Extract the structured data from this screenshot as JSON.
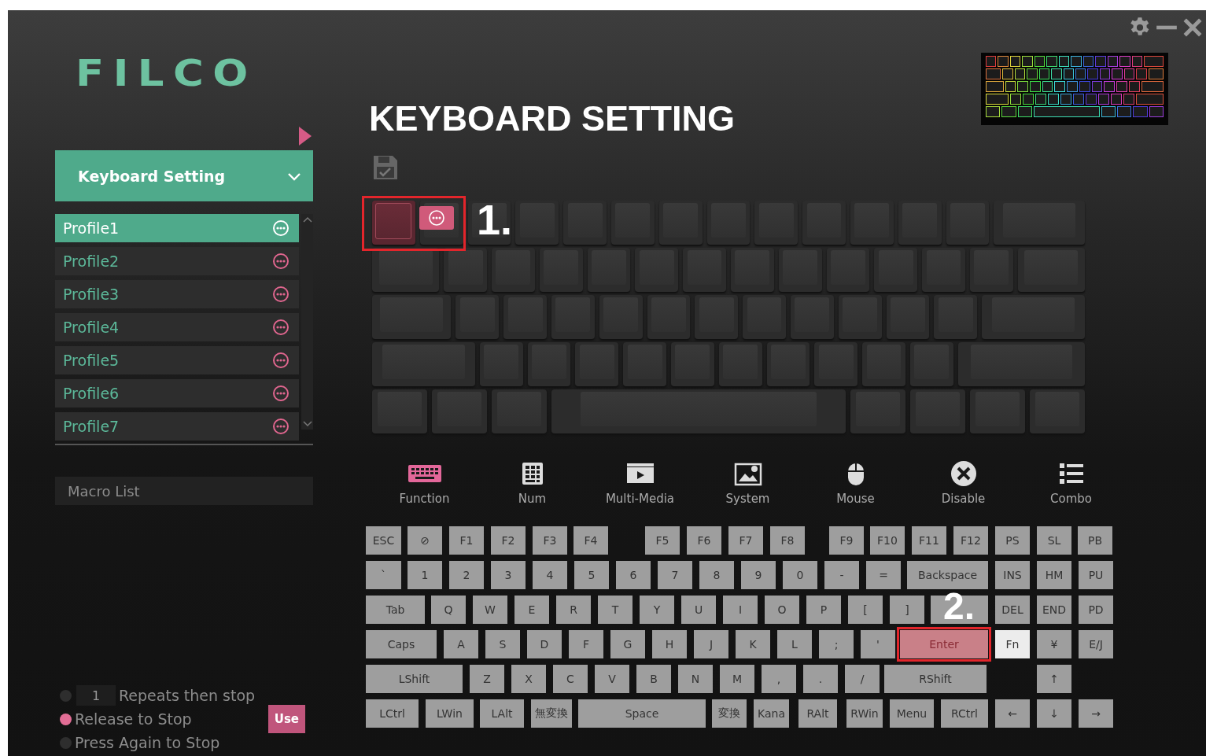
{
  "logo": "FILCO",
  "sidebar": {
    "section": {
      "label": "Keyboard Setting",
      "expanded": true
    },
    "profiles": [
      {
        "label": "Profile1",
        "selected": true
      },
      {
        "label": "Profile2",
        "selected": false
      },
      {
        "label": "Profile3",
        "selected": false
      },
      {
        "label": "Profile4",
        "selected": false
      },
      {
        "label": "Profile5",
        "selected": false
      },
      {
        "label": "Profile6",
        "selected": false
      },
      {
        "label": "Profile7",
        "selected": false
      }
    ],
    "macro_list": {
      "label": "Macro List"
    },
    "stop_options": [
      {
        "kind": "repeat",
        "value": "1",
        "label": "Repeats then stop",
        "selected": false
      },
      {
        "kind": "plain",
        "label": "Release to Stop",
        "selected": true
      },
      {
        "kind": "plain",
        "label": "Press Again to Stop",
        "selected": false
      }
    ],
    "use_button": "Use"
  },
  "title": "KEYBOARD SETTING",
  "annotations": [
    "1.",
    "2."
  ],
  "categories": [
    {
      "label": "Function",
      "selected": true
    },
    {
      "label": "Num",
      "selected": false
    },
    {
      "label": "Multi-Media",
      "selected": false
    },
    {
      "label": "System",
      "selected": false
    },
    {
      "label": "Mouse",
      "selected": false
    },
    {
      "label": "Disable",
      "selected": false
    },
    {
      "label": "Combo",
      "selected": false
    }
  ],
  "keys": [
    [
      {
        "label": "ESC",
        "selected": false,
        "active": false
      },
      {
        "label": "⊘",
        "selected": false,
        "active": false
      },
      {
        "label": "F1",
        "selected": false,
        "active": false
      },
      {
        "label": "F2",
        "selected": false,
        "active": false
      },
      {
        "label": "F3",
        "selected": false,
        "active": false
      },
      {
        "label": "F4",
        "selected": false,
        "active": false
      },
      {
        "label": "F5",
        "selected": false,
        "active": false
      },
      {
        "label": "F6",
        "selected": false,
        "active": false
      },
      {
        "label": "F7",
        "selected": false,
        "active": false
      },
      {
        "label": "F8",
        "selected": false,
        "active": false
      },
      {
        "label": "F9",
        "selected": false,
        "active": false
      },
      {
        "label": "F10",
        "selected": false,
        "active": false
      },
      {
        "label": "F11",
        "selected": false,
        "active": false
      },
      {
        "label": "F12",
        "selected": false,
        "active": false
      },
      {
        "label": "PS",
        "selected": false,
        "active": false
      },
      {
        "label": "SL",
        "selected": false,
        "active": false
      },
      {
        "label": "PB",
        "selected": false,
        "active": false
      }
    ],
    [
      {
        "label": "`",
        "selected": false,
        "active": false
      },
      {
        "label": "1",
        "selected": false,
        "active": false
      },
      {
        "label": "2",
        "selected": false,
        "active": false
      },
      {
        "label": "3",
        "selected": false,
        "active": false
      },
      {
        "label": "4",
        "selected": false,
        "active": false
      },
      {
        "label": "5",
        "selected": false,
        "active": false
      },
      {
        "label": "6",
        "selected": false,
        "active": false
      },
      {
        "label": "7",
        "selected": false,
        "active": false
      },
      {
        "label": "8",
        "selected": false,
        "active": false
      },
      {
        "label": "9",
        "selected": false,
        "active": false
      },
      {
        "label": "0",
        "selected": false,
        "active": false
      },
      {
        "label": "-",
        "selected": false,
        "active": false
      },
      {
        "label": "=",
        "selected": false,
        "active": false
      },
      {
        "label": "Backspace",
        "selected": false,
        "active": false
      },
      {
        "label": "INS",
        "selected": false,
        "active": false
      },
      {
        "label": "HM",
        "selected": false,
        "active": false
      },
      {
        "label": "PU",
        "selected": false,
        "active": false
      }
    ],
    [
      {
        "label": "Tab",
        "selected": false,
        "active": false
      },
      {
        "label": "Q",
        "selected": false,
        "active": false
      },
      {
        "label": "W",
        "selected": false,
        "active": false
      },
      {
        "label": "E",
        "selected": false,
        "active": false
      },
      {
        "label": "R",
        "selected": false,
        "active": false
      },
      {
        "label": "T",
        "selected": false,
        "active": false
      },
      {
        "label": "Y",
        "selected": false,
        "active": false
      },
      {
        "label": "U",
        "selected": false,
        "active": false
      },
      {
        "label": "I",
        "selected": false,
        "active": false
      },
      {
        "label": "O",
        "selected": false,
        "active": false
      },
      {
        "label": "P",
        "selected": false,
        "active": false
      },
      {
        "label": "[",
        "selected": false,
        "active": false
      },
      {
        "label": "]",
        "selected": false,
        "active": false
      },
      {
        "selected": false,
        "active": false
      },
      {
        "label": "DEL",
        "selected": false,
        "active": false
      },
      {
        "label": "END",
        "selected": false,
        "active": false
      },
      {
        "label": "PD",
        "selected": false,
        "active": false
      }
    ],
    [
      {
        "label": "Caps",
        "selected": false,
        "active": false
      },
      {
        "label": "A",
        "selected": false,
        "active": false
      },
      {
        "label": "S",
        "selected": false,
        "active": false
      },
      {
        "label": "D",
        "selected": false,
        "active": false
      },
      {
        "label": "F",
        "selected": false,
        "active": false
      },
      {
        "label": "G",
        "selected": false,
        "active": false
      },
      {
        "label": "H",
        "selected": false,
        "active": false
      },
      {
        "label": "J",
        "selected": false,
        "active": false
      },
      {
        "label": "K",
        "selected": false,
        "active": false
      },
      {
        "label": "L",
        "selected": false,
        "active": false
      },
      {
        "label": ";",
        "selected": false,
        "active": false
      },
      {
        "label": "'",
        "selected": false,
        "active": false
      },
      {
        "label": "Enter",
        "selected": true,
        "active": false
      },
      {
        "label": "Fn",
        "selected": false,
        "active": true
      },
      {
        "label": "¥",
        "selected": false,
        "active": false
      },
      {
        "label": "E/J",
        "selected": false,
        "active": false
      }
    ],
    [
      {
        "label": "LShift",
        "selected": false,
        "active": false
      },
      {
        "label": "Z",
        "selected": false,
        "active": false
      },
      {
        "label": "X",
        "selected": false,
        "active": false
      },
      {
        "label": "C",
        "selected": false,
        "active": false
      },
      {
        "label": "V",
        "selected": false,
        "active": false
      },
      {
        "label": "B",
        "selected": false,
        "active": false
      },
      {
        "label": "N",
        "selected": false,
        "active": false
      },
      {
        "label": "M",
        "selected": false,
        "active": false
      },
      {
        "label": ",",
        "selected": false,
        "active": false
      },
      {
        "label": ".",
        "selected": false,
        "active": false
      },
      {
        "label": "/",
        "selected": false,
        "active": false
      },
      {
        "label": "RShift",
        "selected": false,
        "active": false
      },
      {
        "label": "↑",
        "selected": false,
        "active": false
      }
    ],
    [
      {
        "label": "LCtrl",
        "selected": false,
        "active": false
      },
      {
        "label": "LWin",
        "selected": false,
        "active": false
      },
      {
        "label": "LAlt",
        "selected": false,
        "active": false
      },
      {
        "label": "無変換",
        "selected": false,
        "active": false
      },
      {
        "label": "Space",
        "selected": false,
        "active": false
      },
      {
        "label": "変換",
        "selected": false,
        "active": false
      },
      {
        "label": "Kana",
        "selected": false,
        "active": false
      },
      {
        "label": "RAlt",
        "selected": false,
        "active": false
      },
      {
        "label": "RWin",
        "selected": false,
        "active": false
      },
      {
        "label": "Menu",
        "selected": false,
        "active": false
      },
      {
        "label": "RCtrl",
        "selected": false,
        "active": false
      },
      {
        "label": "←",
        "selected": false,
        "active": false
      },
      {
        "label": "↓",
        "selected": false,
        "active": false
      },
      {
        "label": "→",
        "selected": false,
        "active": false
      }
    ]
  ]
}
